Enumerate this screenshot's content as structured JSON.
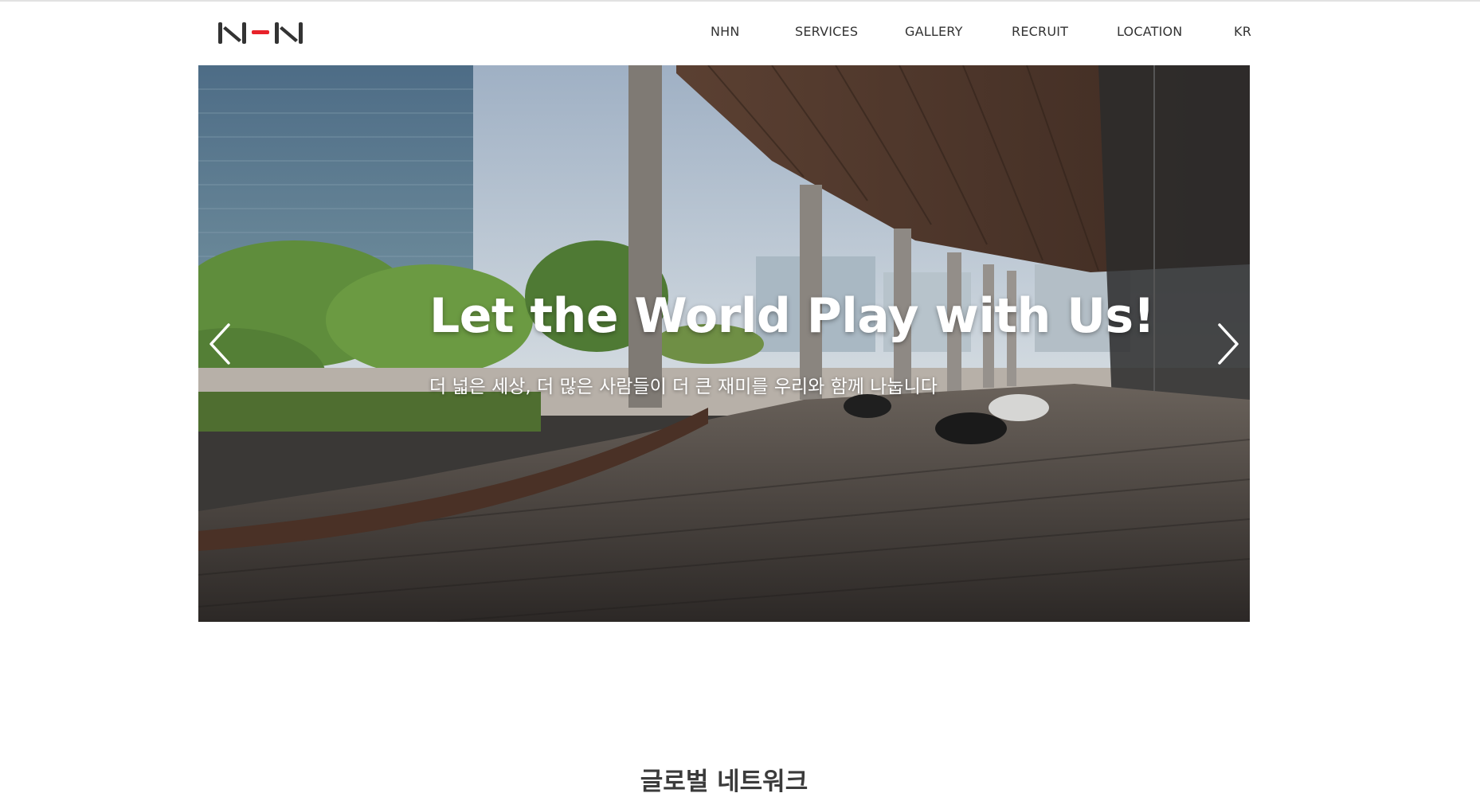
{
  "header": {
    "logo_text": "NHN",
    "nav": [
      "NHN",
      "SERVICES",
      "GALLERY",
      "RECRUIT",
      "LOCATION",
      "KR"
    ]
  },
  "hero": {
    "title": "Let the World Play with Us!",
    "subtitle": "더 넓은 세상, 더 많은 사람들이 더 큰 재미를 우리와 함께 나눕니다",
    "prev_icon": "chevron-left-icon",
    "next_icon": "chevron-right-icon"
  },
  "section": {
    "title": "글로벌 네트워크"
  },
  "colors": {
    "logo_dark": "#333333",
    "logo_accent": "#e8222a",
    "nav_text": "#333333"
  }
}
